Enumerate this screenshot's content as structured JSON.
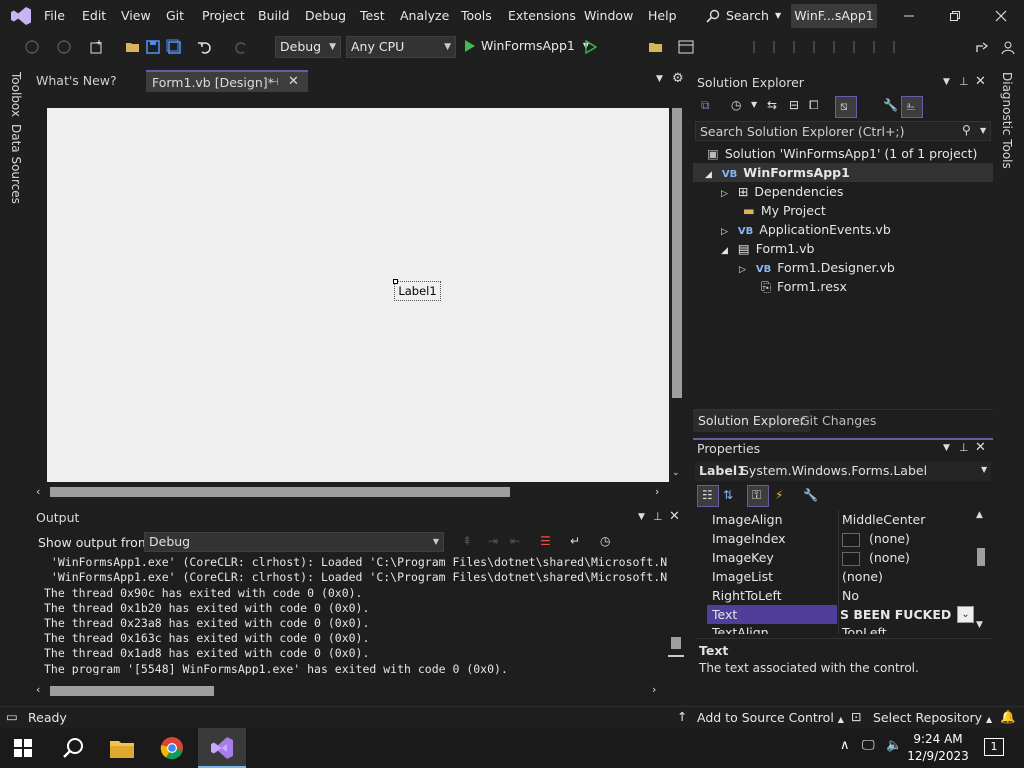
{
  "titlebar": {
    "menu": [
      "File",
      "Edit",
      "View",
      "Git",
      "Project",
      "Build",
      "Debug",
      "Test",
      "Analyze",
      "Tools",
      "Extensions",
      "Window",
      "Help"
    ],
    "search_label": "Search",
    "app_badge": "WinF...sApp1"
  },
  "toolbar": {
    "config": "Debug",
    "platform": "Any CPU",
    "run_target": "WinFormsApp1"
  },
  "side_strip": {
    "left": [
      "Toolbox",
      "Data Sources"
    ],
    "right": "Diagnostic Tools"
  },
  "doc_tabs": [
    {
      "label": "What's New?"
    },
    {
      "label": "Form1.vb [Design]*"
    }
  ],
  "designer": {
    "label1_text": "Label1"
  },
  "output": {
    "title": "Output",
    "show_from_label": "Show output from:",
    "show_from_value": "Debug",
    "lines": [
      " 'WinFormsApp1.exe' (CoreCLR: clrhost): Loaded 'C:\\Program Files\\dotnet\\shared\\Microsoft.N",
      " 'WinFormsApp1.exe' (CoreCLR: clrhost): Loaded 'C:\\Program Files\\dotnet\\shared\\Microsoft.N",
      "The thread 0x90c has exited with code 0 (0x0).",
      "The thread 0x1b20 has exited with code 0 (0x0).",
      "The thread 0x23a8 has exited with code 0 (0x0).",
      "The thread 0x163c has exited with code 0 (0x0).",
      "The thread 0x1ad8 has exited with code 0 (0x0).",
      "The program '[5548] WinFormsApp1.exe' has exited with code 0 (0x0)."
    ]
  },
  "solution_explorer": {
    "title": "Solution Explorer",
    "search_placeholder": "Search Solution Explorer (Ctrl+;)",
    "tree": [
      {
        "label": "Solution 'WinFormsApp1' (1 of 1 project)",
        "icon": "solution-icon"
      },
      {
        "label": "WinFormsApp1",
        "icon": "vb-project-icon"
      },
      {
        "label": "Dependencies",
        "icon": "dependencies-icon"
      },
      {
        "label": "My Project",
        "icon": "folder-icon"
      },
      {
        "label": "ApplicationEvents.vb",
        "icon": "vb-file-icon"
      },
      {
        "label": "Form1.vb",
        "icon": "form-icon"
      },
      {
        "label": "Form1.Designer.vb",
        "icon": "vb-file-icon"
      },
      {
        "label": "Form1.resx",
        "icon": "resx-icon"
      }
    ],
    "bottom_tabs": [
      "Solution Explorer",
      "Git Changes"
    ]
  },
  "properties": {
    "title": "Properties",
    "object_name": "Label1",
    "object_type": "System.Windows.Forms.Label",
    "rows": [
      {
        "name": "ImageAlign",
        "value": "MiddleCenter"
      },
      {
        "name": "ImageIndex",
        "value": "(none)"
      },
      {
        "name": "ImageKey",
        "value": "(none)"
      },
      {
        "name": "ImageList",
        "value": "(none)"
      },
      {
        "name": "RightToLeft",
        "value": "No"
      },
      {
        "name": "Text",
        "value": "S BEEN FUCKED BY A"
      },
      {
        "name": "TextAlign",
        "value": "TopLeft"
      }
    ],
    "desc_title": "Text",
    "desc_body": "The text associated with the control."
  },
  "statusbar": {
    "ready": "Ready",
    "source_control": "Add to Source Control",
    "repository": "Select Repository"
  },
  "taskbar": {
    "time": "9:24 AM",
    "date": "12/9/2023",
    "notifications": "1"
  },
  "colors": {
    "accent": "#6c5aa8",
    "selection": "#4f3f9a",
    "run_green": "#3fb950"
  }
}
